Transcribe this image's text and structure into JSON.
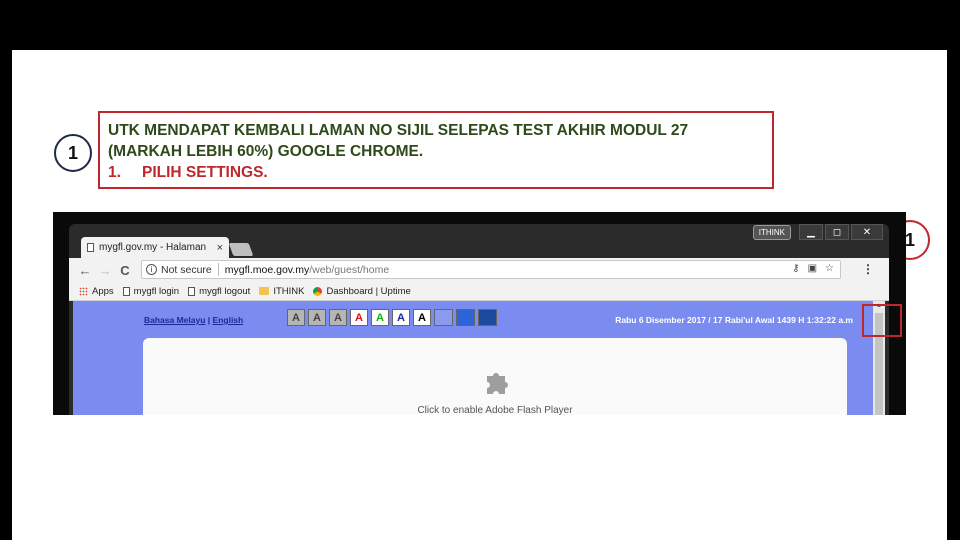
{
  "step_marker": "1",
  "instruction": {
    "line1": "UTK MENDAPAT KEMBALI LAMAN NO SIJIL SELEPAS TEST AKHIR MODUL 27",
    "line2": "(MARKAH LEBIH 60%)  GOOGLE CHROME.",
    "step_number": "1.",
    "step_text": "PILIH SETTINGS."
  },
  "browser": {
    "tab_title": "mygfl.gov.my - Halaman",
    "tab_close": "×",
    "profile_name": "ITHINK",
    "window_buttons": {
      "minimize": "▁",
      "maximize": "◻",
      "close": "✕"
    },
    "nav": {
      "back": "←",
      "forward": "→",
      "reload": "C"
    },
    "security_label": "Not secure",
    "url_host": "mygfl.moe.gov.my",
    "url_path": "/web/guest/home",
    "menu_glyph": "⋮",
    "bookmarks": [
      {
        "label": "Apps",
        "icon": "apps-grid-icon"
      },
      {
        "label": "mygfl login",
        "icon": "page-icon"
      },
      {
        "label": "mygfl logout",
        "icon": "page-icon"
      },
      {
        "label": "ITHINK",
        "icon": "folder-icon"
      },
      {
        "label": "Dashboard | Uptime",
        "icon": "chrome-icon"
      }
    ]
  },
  "page": {
    "lang_malay": "Bahasa Melayu",
    "lang_sep": " | ",
    "lang_english": "English",
    "font_buttons": [
      {
        "label": "A",
        "color": "#444444",
        "bg": "#b5b5b5"
      },
      {
        "label": "A",
        "color": "#444444",
        "bg": "#b5b5b5"
      },
      {
        "label": "A",
        "color": "#444444",
        "bg": "#b5b5b5"
      },
      {
        "label": "A",
        "color": "#e01010",
        "bg": "#ffffff"
      },
      {
        "label": "A",
        "color": "#13b20f",
        "bg": "#ffffff"
      },
      {
        "label": "A",
        "color": "#1a2a9a",
        "bg": "#ffffff"
      },
      {
        "label": "A",
        "color": "#000000",
        "bg": "#ffffff"
      }
    ],
    "swatches": [
      "#8a9af0",
      "#2f63d8",
      "#1c4a9c"
    ],
    "datetime": "Rabu 6 Disember 2017 / 17 Rabi'ul Awal 1439 H  1:32:22 a.m",
    "flash_text": "Click to enable Adobe Flash Player"
  },
  "colors": {
    "accent_red": "#c0272d",
    "instruction_green": "#2e4a1a",
    "page_bg": "#7a8cf0"
  }
}
